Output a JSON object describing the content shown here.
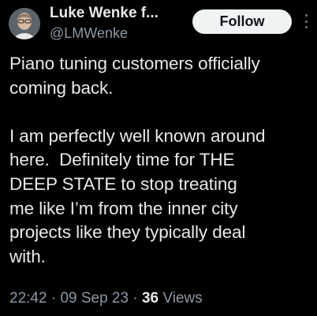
{
  "author": {
    "display_name": "Luke Wenke f...",
    "handle": "@LMWenke",
    "avatar_icon": "profile-photo"
  },
  "header": {
    "follow_label": "Follow",
    "more_icon": "more-vertical-icon"
  },
  "tweet": {
    "text": "Piano tuning customers officially\ncoming back.\n\nI am perfectly well known around\nhere.  Definitely time for THE\nDEEP STATE to stop treating\nme like I’m from the inner city\nprojects like they typically deal\nwith.",
    "time": "22:42",
    "date": "09 Sep 23",
    "separator": "·",
    "views_count": "36",
    "views_label": "Views"
  },
  "colors": {
    "background": "#000000",
    "text": "#e7e9ea",
    "secondary_text": "#8b98a5",
    "button_bg": "#eff3f4",
    "button_text": "#0f1419"
  }
}
